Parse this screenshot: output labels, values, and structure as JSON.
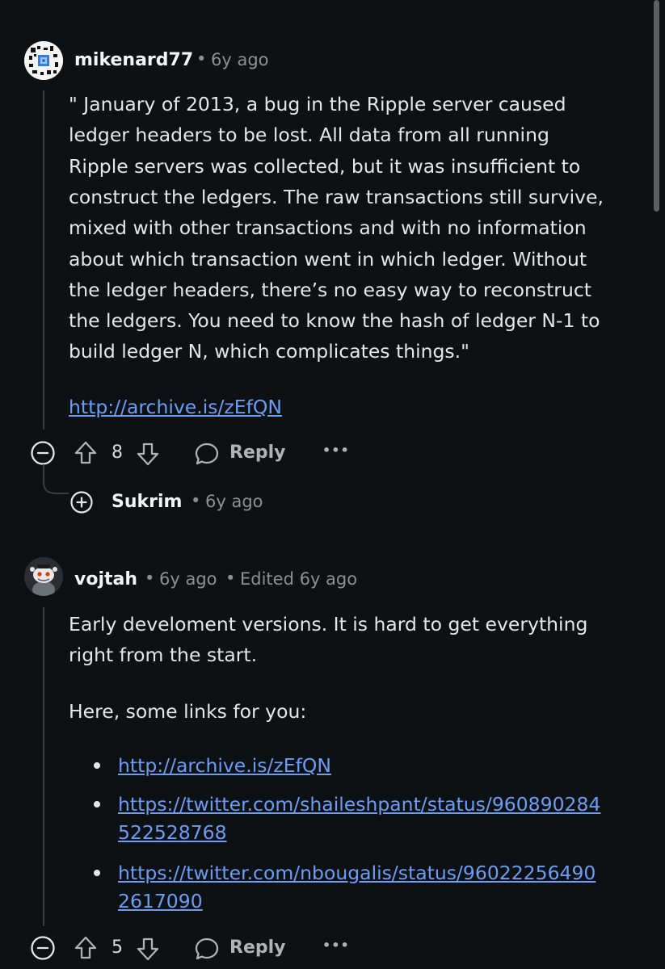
{
  "comments": [
    {
      "username": "mikenard77",
      "time": "6y ago",
      "body_lines": [
        "\" January of 2013, a bug in the Ripple server caused",
        "ledger headers to be lost. All data from all running",
        "Ripple servers was collected, but it was insufficient to",
        "construct the ledgers. The raw transactions still survive,",
        "mixed with other transactions and with no information",
        "about which transaction went in which ledger. Without",
        "the ledger headers, there’s no easy way to reconstruct",
        "the ledgers. You need to know the hash of ledger N-1 to",
        "build ledger N, which complicates things.\""
      ],
      "link": "http://archive.is/zEfQN",
      "votes": "8",
      "reply_label": "Reply",
      "more_label": "•••"
    },
    {
      "username": "vojtah",
      "time": "6y ago",
      "edited": "Edited 6y ago",
      "body_lines": [
        "Early develoment versions. It is hard to get everything",
        "right from the start."
      ],
      "intro": "Here, some links for you:",
      "links": [
        {
          "lines": [
            "http://archive.is/zEfQN"
          ]
        },
        {
          "lines": [
            "https://twitter.com/shaileshpant/status/960890284",
            "522528768"
          ]
        },
        {
          "lines": [
            "https://twitter.com/nbougalis/status/96022256490",
            "2617090"
          ]
        }
      ],
      "votes": "5",
      "reply_label": "Reply",
      "more_label": "•••"
    }
  ],
  "collapsed_reply": {
    "username": "Sukrim",
    "time": "6y ago"
  },
  "separator": "•",
  "icons": {
    "collapse": "minus-circle-icon",
    "expand": "plus-circle-icon",
    "upvote": "upvote-arrow-icon",
    "downvote": "downvote-arrow-icon",
    "reply": "speech-bubble-icon",
    "more": "more-dots-icon"
  },
  "colors": {
    "background": "#0e1113",
    "text": "#e4e6e8",
    "muted": "#8a9196",
    "link": "#6b9df7",
    "thread_line": "#3a3d40"
  }
}
